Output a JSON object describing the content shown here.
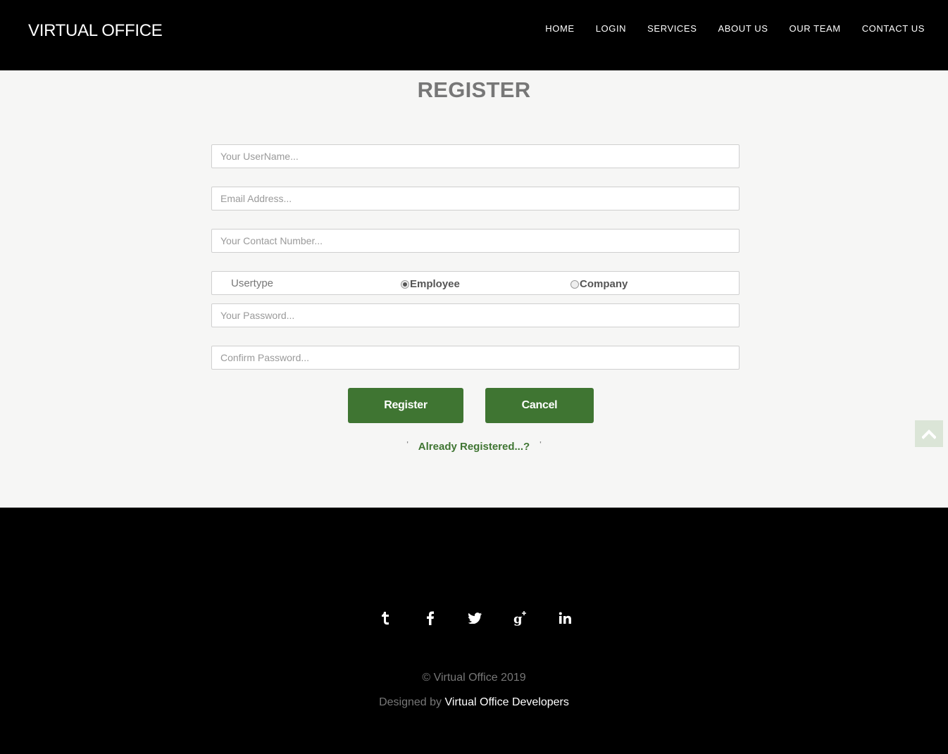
{
  "header": {
    "brand": "VIRTUAL OFFICE",
    "nav": [
      "HOME",
      "LOGIN",
      "SERVICES",
      "ABOUT US",
      "OUR TEAM",
      "CONTACT US"
    ]
  },
  "form": {
    "title": "REGISTER",
    "username_placeholder": "Your UserName...",
    "email_placeholder": "Email Address...",
    "contact_placeholder": "Your Contact Number...",
    "usertype_label": "Usertype",
    "usertype_options": [
      "Employee",
      "Company"
    ],
    "usertype_selected": "Employee",
    "password_placeholder": "Your Password...",
    "confirm_placeholder": "Confirm Password...",
    "register_label": "Register",
    "cancel_label": "Cancel",
    "already_registered": "Already Registered...?",
    "bullet": "'"
  },
  "footer": {
    "social_icons": [
      "tumblr-icon",
      "facebook-icon",
      "twitter-icon",
      "google-plus-icon",
      "linkedin-icon"
    ],
    "copyright": "© Virtual Office 2019",
    "designed_by": "Designed by",
    "developer": "Virtual Office Developers"
  },
  "colors": {
    "accent": "#3f7532",
    "header_bg": "#000000",
    "main_bg": "#f6f6f5"
  }
}
